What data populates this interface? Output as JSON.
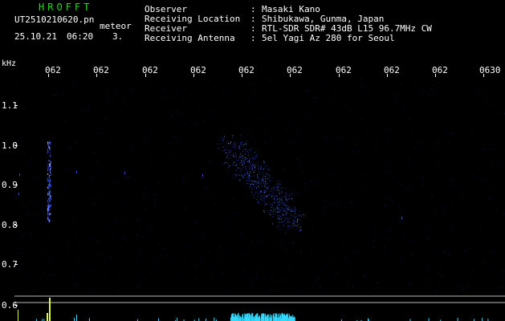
{
  "header": {
    "app_title": "HROFFT",
    "file_name": "UT2510210620.pn",
    "meteor_label": "meteor",
    "date": "25.10.21",
    "time": "06:20",
    "count": "3."
  },
  "info": [
    {
      "key": "Observer",
      "value": "Masaki Kano"
    },
    {
      "key": "Receiving Location",
      "value": "Shibukawa, Gunma, Japan"
    },
    {
      "key": "Receiver",
      "value": "RTL-SDR SDR# 43dB L15 96.7MHz CW"
    },
    {
      "key": "Receiving Antenna",
      "value": "5el Yagi Az 280 for Seoul"
    }
  ],
  "spectrogram": {
    "unit_label": "kHz",
    "x_ticks": [
      "062",
      "062",
      "062",
      "062",
      "062",
      "062",
      "062",
      "062",
      "062",
      "0630"
    ],
    "y_ticks": [
      "1.1",
      "1.0",
      "0.9",
      "0.8",
      "0.7",
      "0.6"
    ],
    "colors": {
      "background": "#000000",
      "signal": "#2f4dff",
      "signal_hot": "#9fb4ff",
      "power_trace": "#33d9ff",
      "power_peak": "#e0ff33",
      "baseline": "#bbbbbb"
    }
  }
}
